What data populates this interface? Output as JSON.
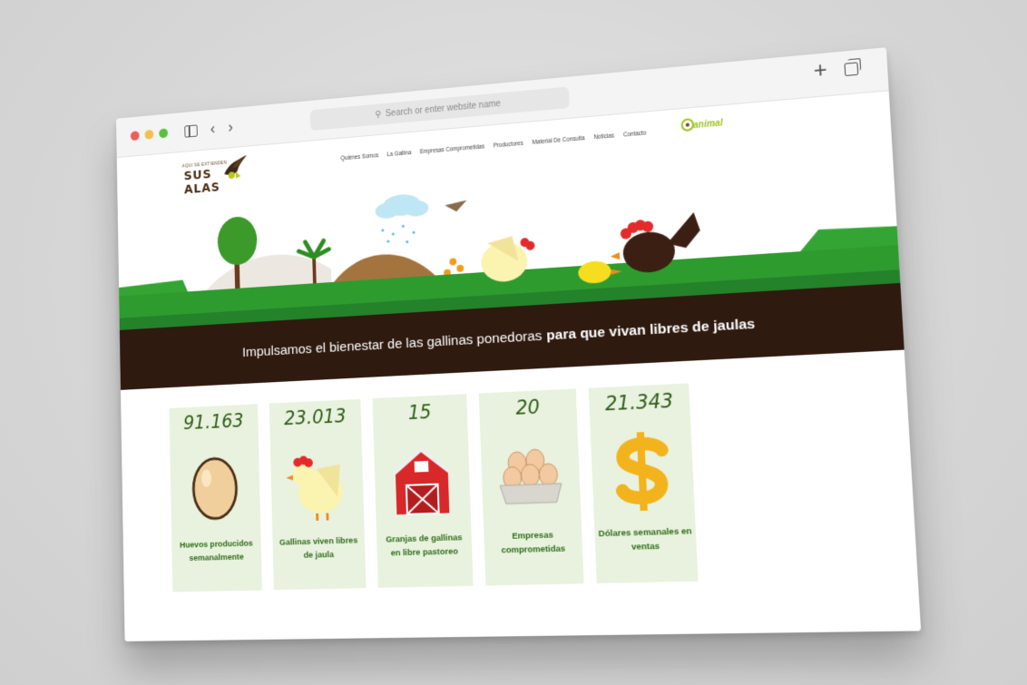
{
  "browser": {
    "url_placeholder": "Search or enter website name"
  },
  "site": {
    "logo": {
      "small_text": "AQUI SE EXTIENDEN",
      "big_text": "SUS ALAS"
    },
    "menu": [
      {
        "label": "Quiénes Somos"
      },
      {
        "label": "La Gallina"
      },
      {
        "label": "Empresas Comprometidas"
      },
      {
        "label": "Productores"
      },
      {
        "label": "Material De Consulta"
      },
      {
        "label": "Noticias"
      },
      {
        "label": "Contacto"
      }
    ],
    "partner_logo_text": "animal",
    "banner": {
      "text_regular": "Impulsamos el bienestar de las gallinas ponedoras",
      "text_bold": "para que vivan libres de jaulas"
    },
    "stats": [
      {
        "value": "91.163",
        "label": "Huevos producidos semanalmente",
        "icon": "egg-icon"
      },
      {
        "value": "23.013",
        "label": "Gallinas viven libres de jaula",
        "icon": "hen-icon"
      },
      {
        "value": "15",
        "label": "Granjas de gallinas en libre pastoreo",
        "icon": "barn-icon"
      },
      {
        "value": "20",
        "label": "Empresas comprometidas",
        "icon": "egg-carton-icon"
      },
      {
        "value": "21.343",
        "label": "Dólares semanales en ventas",
        "icon": "dollar-icon"
      }
    ]
  },
  "colors": {
    "banner_bg": "#2f1a0f",
    "grass_green": "#2e9b2f",
    "card_bg": "#e8f2de",
    "stat_number": "#2f5d1a",
    "stat_label": "#2f6d1a"
  }
}
